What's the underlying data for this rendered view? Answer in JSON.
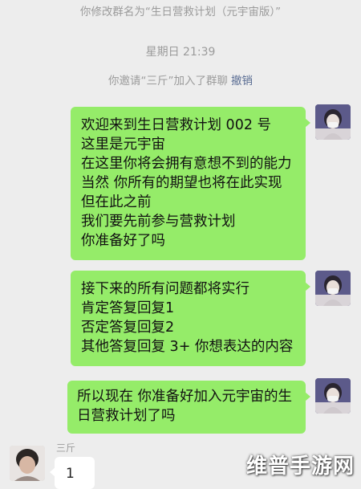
{
  "system_messages": {
    "rename": "你修改群名为“生日营救计划（元宇宙版）”",
    "time": "星期日 21:39",
    "invite": "你邀请“三斤”加入了群聊",
    "revoke": "撤销"
  },
  "messages": [
    {
      "side": "right",
      "lines": [
        "欢迎来到生日营救计划 002 号",
        "这里是元宇宙",
        "在这里你将会拥有意想不到的能力",
        "当然 你所有的期望也将在此实现",
        "但在此之前",
        "我们要先前参与营救计划",
        "你准备好了吗"
      ]
    },
    {
      "side": "right",
      "lines": [
        "接下来的所有问题都将实行",
        "肯定答复回复1",
        "否定答复回复2",
        "其他答复回复 3+ 你想表达的内容"
      ]
    },
    {
      "side": "right",
      "lines": [
        "所以现在 你准备好加入元宇宙的生日营救计划了吗"
      ]
    },
    {
      "side": "left",
      "sender": "三斤",
      "text": "1"
    }
  ],
  "watermark": "维普手游网",
  "colors": {
    "background": "#ededed",
    "own_bubble": "#95ec69",
    "other_bubble": "#ffffff",
    "system_text": "#9b9b9b",
    "link": "#5b6e94"
  }
}
